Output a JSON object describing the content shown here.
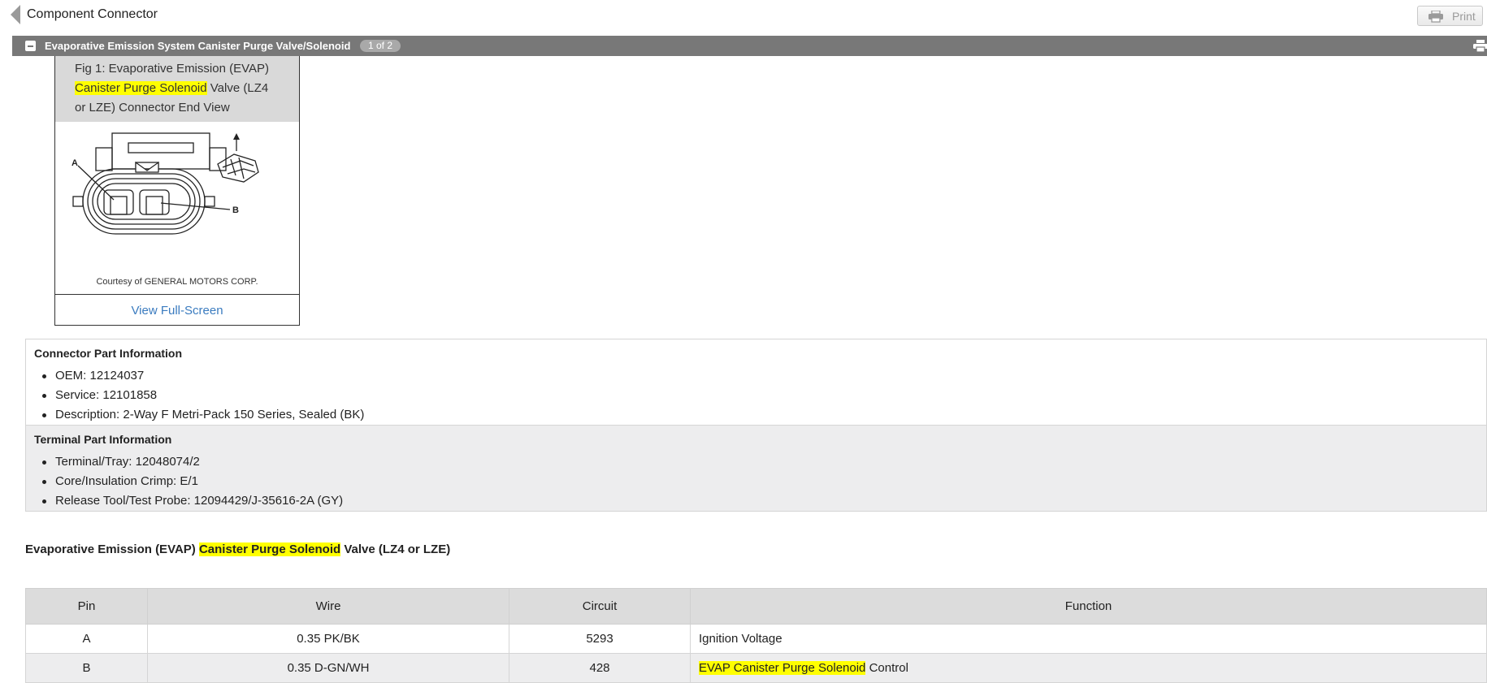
{
  "topbar": {
    "title": "Component Connector",
    "print_label": "Print"
  },
  "section": {
    "title": "Evaporative Emission System Canister Purge Valve/Solenoid",
    "pager": "1 of 2"
  },
  "figure": {
    "caption_before": "Fig 1: Evaporative Emission (EVAP)",
    "caption_highlight": "Canister Purge Solenoid",
    "caption_after": "Valve (LZ4 or LZE) Connector End View",
    "pin_label_a": "A",
    "pin_label_b": "B",
    "courtesy": "Courtesy of GENERAL MOTORS CORP.",
    "link": "View Full-Screen"
  },
  "connector_info": {
    "heading": "Connector Part Information",
    "items": [
      "OEM: 12124037",
      "Service: 12101858",
      "Description: 2-Way F Metri-Pack 150 Series, Sealed (BK)"
    ]
  },
  "terminal_info": {
    "heading": "Terminal Part Information",
    "items": [
      "Terminal/Tray: 12048074/2",
      "Core/Insulation Crimp: E/1",
      "Release Tool/Test Probe: 12094429/J-35616-2A (GY)"
    ]
  },
  "pin_table": {
    "title_before": "Evaporative Emission (EVAP)",
    "title_highlight": "Canister Purge Solenoid",
    "title_after": "Valve (LZ4 or LZE)",
    "headers": [
      "Pin",
      "Wire",
      "Circuit",
      "Function"
    ],
    "rows": [
      {
        "pin": "A",
        "wire": "0.35 PK/BK",
        "circuit": "5293",
        "function_highlight": "",
        "function_text": "Ignition Voltage"
      },
      {
        "pin": "B",
        "wire": "0.35 D-GN/WH",
        "circuit": "428",
        "function_highlight": "EVAP Canister Purge Solenoid",
        "function_text": "Control"
      }
    ]
  },
  "colors": {
    "section_bar": "#787878",
    "highlight": "#ffff00",
    "link": "#3a7bbf"
  }
}
